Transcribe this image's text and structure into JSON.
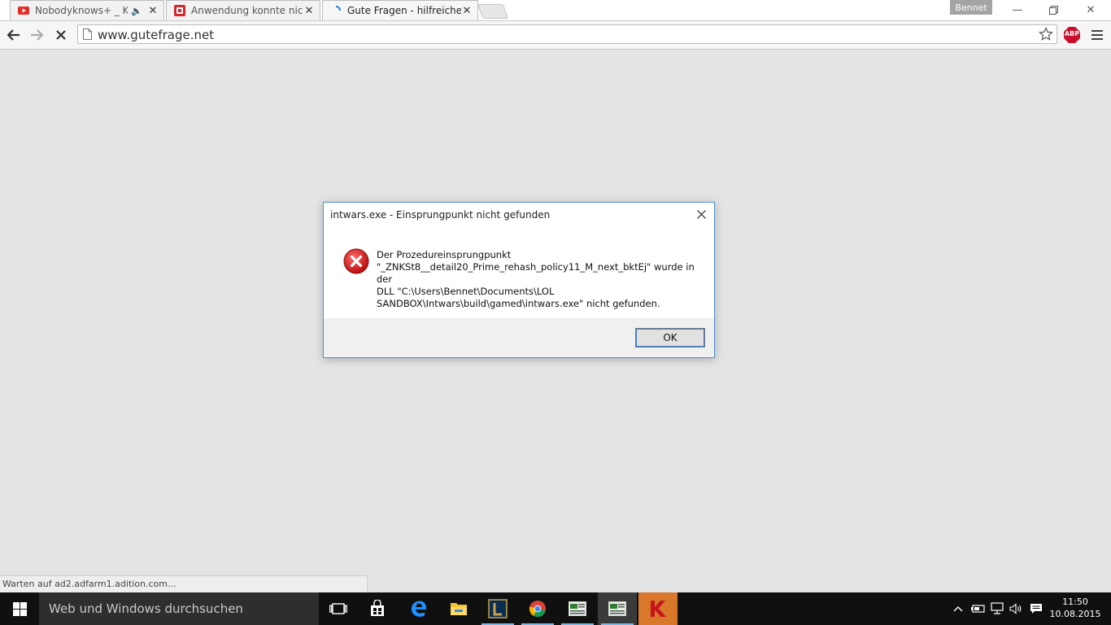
{
  "browser": {
    "tabs": [
      {
        "title": "Nobodyknows+ _ Koko",
        "icon": "youtube-icon"
      },
      {
        "title": "Anwendung konnte nicht",
        "icon": "gutefrage-icon"
      },
      {
        "title": "Gute Fragen - hilfreiche A",
        "icon": "loading-spinner-icon"
      }
    ],
    "profile_name": "Bennet",
    "url": "www.gutefrage.net",
    "abp_label": "ABP",
    "status_text": "Warten auf ad2.adfarm1.adition.com..."
  },
  "dialog": {
    "title": "intwars.exe - Einsprungpunkt nicht gefunden",
    "message_lines": [
      "Der Prozedureinsprungpunkt",
      "\"_ZNKSt8__detail20_Prime_rehash_policy11_M_next_bktEj\" wurde in der",
      "DLL \"C:\\Users\\Bennet\\Documents\\LOL",
      "SANDBOX\\Intwars\\build\\gamed\\intwars.exe\" nicht gefunden."
    ],
    "ok_label": "OK"
  },
  "taskbar": {
    "search_placeholder": "Web und Windows durchsuchen",
    "time": "11:50",
    "date": "10.08.2015"
  },
  "colors": {
    "accent": "#4c8fd6",
    "error_red": "#c81818",
    "taskbar": "#101010",
    "abp_red": "#c8102e"
  }
}
